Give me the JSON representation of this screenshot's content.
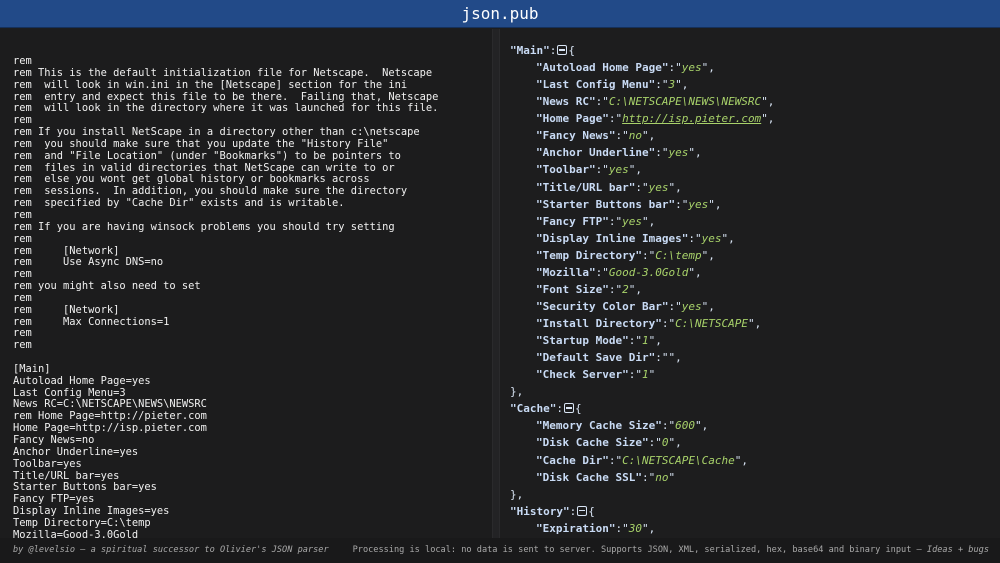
{
  "header": {
    "title": "json.pub"
  },
  "input_lines": [
    "rem",
    "rem This is the default initialization file for Netscape.  Netscape",
    "rem  will look in win.ini in the [Netscape] section for the ini",
    "rem  entry and expect this file to be there.  Failing that, Netscape",
    "rem  will look in the directory where it was launched for this file.",
    "rem",
    "rem If you install NetScape in a directory other than c:\\netscape",
    "rem  you should make sure that you update the \"History File\"",
    "rem  and \"File Location\" (under \"Bookmarks\") to be pointers to",
    "rem  files in valid directories that NetScape can write to or",
    "rem  else you wont get global history or bookmarks across",
    "rem  sessions.  In addition, you should make sure the directory",
    "rem  specified by \"Cache Dir\" exists and is writable.",
    "rem",
    "rem If you are having winsock problems you should try setting",
    "rem",
    "rem     [Network]",
    "rem     Use Async DNS=no",
    "rem",
    "rem you might also need to set",
    "rem",
    "rem     [Network]",
    "rem     Max Connections=1",
    "rem",
    "rem",
    "",
    "[Main]",
    "Autoload Home Page=yes",
    "Last Config Menu=3",
    "News RC=C:\\NETSCAPE\\NEWS\\NEWSRC",
    "rem Home Page=http://pieter.com",
    "Home Page=http://isp.pieter.com",
    "Fancy News=no",
    "Anchor Underline=yes",
    "Toolbar=yes",
    "Title/URL bar=yes",
    "Starter Buttons bar=yes",
    "Fancy FTP=yes",
    "Display Inline Images=yes",
    "Temp Directory=C:\\temp",
    "Mozilla=Good-3.0Gold"
  ],
  "output": {
    "sections": [
      {
        "name": "Main",
        "entries": [
          [
            "Autoload Home Page",
            "yes"
          ],
          [
            "Last Config Menu",
            "3"
          ],
          [
            "News RC",
            "C:\\NETSCAPE\\NEWS\\NEWSRC"
          ],
          [
            "Home Page",
            "http://isp.pieter.com"
          ],
          [
            "Fancy News",
            "no"
          ],
          [
            "Anchor Underline",
            "yes"
          ],
          [
            "Toolbar",
            "yes"
          ],
          [
            "Title/URL bar",
            "yes"
          ],
          [
            "Starter Buttons bar",
            "yes"
          ],
          [
            "Fancy FTP",
            "yes"
          ],
          [
            "Display Inline Images",
            "yes"
          ],
          [
            "Temp Directory",
            "C:\\temp"
          ],
          [
            "Mozilla",
            "Good-3.0Gold"
          ],
          [
            "Font Size",
            "2"
          ],
          [
            "Security Color Bar",
            "yes"
          ],
          [
            "Install Directory",
            "C:\\NETSCAPE"
          ],
          [
            "Startup Mode",
            "1"
          ],
          [
            "Default Save Dir",
            ""
          ],
          [
            "Check Server",
            "1"
          ]
        ]
      },
      {
        "name": "Cache",
        "entries": [
          [
            "Memory Cache Size",
            "600"
          ],
          [
            "Disk Cache Size",
            "0"
          ],
          [
            "Cache Dir",
            "C:\\NETSCAPE\\Cache"
          ],
          [
            "Disk Cache SSL",
            "no"
          ]
        ]
      },
      {
        "name": "History",
        "entries": [
          [
            "Expiration",
            "30"
          ]
        ],
        "truncated": true
      }
    ],
    "link_value": "http://isp.pieter.com"
  },
  "footer": {
    "left_prefix": "by @levelsio — a spiritual successor to ",
    "left_link": "Olivier's JSON parser",
    "right_text": "Processing is local: no data is sent to server. Supports JSON, XML, serialized, hex, base64 and binary input — ",
    "right_link": "Ideas + bugs"
  }
}
